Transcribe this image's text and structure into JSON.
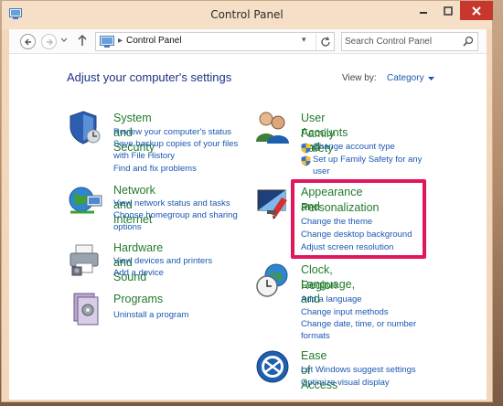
{
  "window": {
    "title": "Control Panel"
  },
  "address": {
    "path": "Control Panel"
  },
  "search": {
    "placeholder": "Search Control Panel"
  },
  "header": {
    "title": "Adjust your computer's settings",
    "view_by_label": "View by:",
    "view_by_value": "Category"
  },
  "categories": {
    "system": {
      "title": "System and Security",
      "links": [
        "Review your computer's status",
        "Save backup copies of your files",
        "with File History",
        "Find and fix problems"
      ]
    },
    "network": {
      "title": "Network and Internet",
      "links": [
        "View network status and tasks",
        "Choose homegroup and sharing",
        "options"
      ]
    },
    "hardware": {
      "title": "Hardware and Sound",
      "links": [
        "View devices and printers",
        "Add a device"
      ]
    },
    "programs": {
      "title": "Programs",
      "links": [
        "Uninstall a program"
      ]
    },
    "user": {
      "title_line1": "User Accounts and",
      "title_line2": "Family Safety",
      "links": [
        "Change account type",
        "Set up Family Safety for any",
        "user"
      ]
    },
    "appearance": {
      "title_line1": "Appearance and",
      "title_line2": "Personalization",
      "links": [
        "Change the theme",
        "Change desktop background",
        "Adjust screen resolution"
      ]
    },
    "clock": {
      "title_line1": "Clock, Language, and",
      "title_line2": "Region",
      "links": [
        "Add a language",
        "Change input methods",
        "Change date, time, or number",
        "formats"
      ]
    },
    "ease": {
      "title": "Ease of Access",
      "links": [
        "Let Windows suggest settings",
        "Optimize visual display"
      ]
    }
  },
  "colors": {
    "highlight": "#e0175f",
    "link": "#1a57b4",
    "category_title": "#237a2c",
    "header": "#1e3287"
  }
}
